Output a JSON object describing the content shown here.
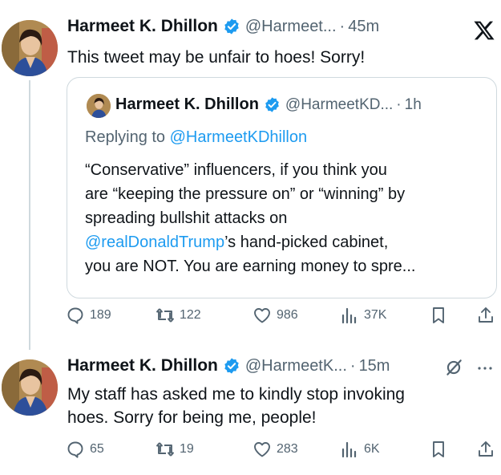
{
  "tweet1": {
    "name": "Harmeet K. Dhillon",
    "handle": "@Harmeet...",
    "sep": "·",
    "time": "45m",
    "text": "This tweet may be unfair to hoes! Sorry!",
    "quote": {
      "name": "Harmeet K. Dhillon",
      "handle": "@HarmeetKD...",
      "time": "1h",
      "replying_prefix": "Replying to ",
      "replying_handle": "@HarmeetKDhillon",
      "line1": "“Conservative” influencers, if you think you",
      "line2": "are “keeping the pressure on” or “winning” by",
      "line3": "spreading bullshit attacks on",
      "line4_mention": "@realDonaldTrump",
      "line4_rest": "’s hand-picked cabinet,",
      "line5": "you are NOT. You are earning money to spre..."
    },
    "actions": {
      "replies": "189",
      "reposts": "122",
      "likes": "986",
      "views": "37K"
    }
  },
  "tweet2": {
    "name": "Harmeet K. Dhillon",
    "handle": "@HarmeetK...",
    "sep": "·",
    "time": "15m",
    "line1": "My staff has asked me to kindly stop invoking",
    "line2": "hoes. Sorry for being me, people!",
    "actions": {
      "replies": "65",
      "reposts": "19",
      "likes": "283",
      "views": "6K"
    }
  },
  "colors": {
    "accent": "#1d9bf0",
    "muted": "#536471",
    "text": "#0f1419",
    "border": "#cfd9de"
  },
  "icons": [
    "verified-badge-icon",
    "x-logo-icon",
    "reply-icon",
    "repost-icon",
    "like-icon",
    "views-icon",
    "bookmark-icon",
    "share-icon",
    "grok-icon",
    "more-icon"
  ]
}
